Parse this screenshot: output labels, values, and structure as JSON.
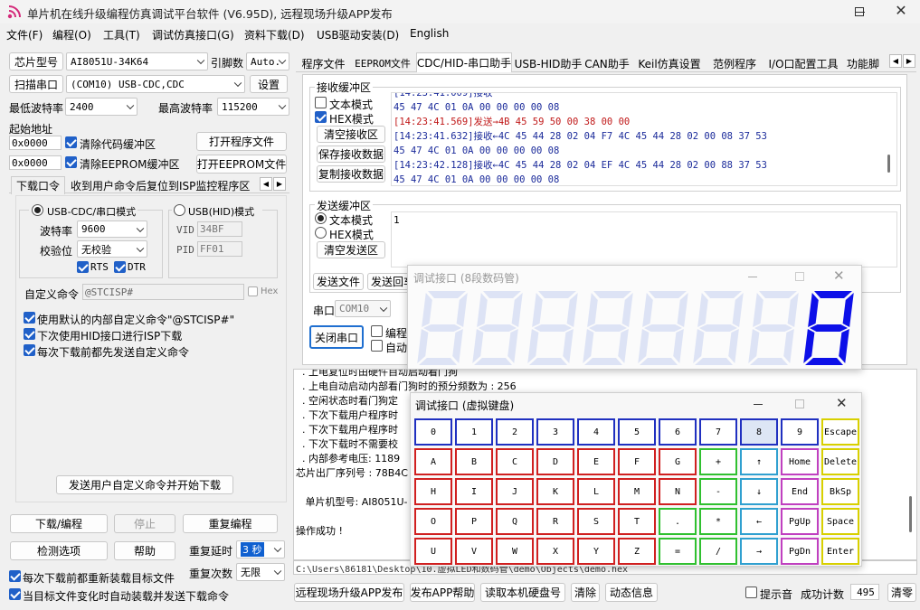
{
  "window": {
    "title": "单片机在线升级编程仿真调试平台软件 (V6.95D), 远程现场升级APP发布"
  },
  "menu": [
    "文件(F)",
    "编程(O)",
    "工具(T)",
    "调试仿真接口(G)",
    "资料下载(D)",
    "USB驱动安装(D)",
    "English"
  ],
  "left": {
    "chip_label": "芯片型号",
    "chip_value": "AI8051U-34K64",
    "pin_label": "引脚数",
    "pin_value": "Auto.",
    "scan_btn": "扫描串口",
    "port_value": "(COM10) USB-CDC,CDC",
    "settings_btn": "设置",
    "min_baud_label": "最低波特率",
    "min_baud_value": "2400",
    "max_baud_label": "最高波特率",
    "max_baud_value": "115200",
    "start_addr_label": "起始地址",
    "addr1": "0x0000",
    "clear_code": "清除代码缓冲区",
    "open_prog": "打开程序文件",
    "addr2": "0x0000",
    "clear_eeprom": "清除EEPROM缓冲区",
    "open_eeprom": "打开EEPROM文件",
    "tabs": [
      "下载口令",
      "收到用户命令后复位到ISP监控程序区"
    ],
    "mode_cdc": "USB-CDC/串口模式",
    "mode_hid": "USB(HID)模式",
    "baud_label": "波特率",
    "baud_value": "9600",
    "parity_label": "校验位",
    "parity_value": "无校验",
    "rts": "RTS",
    "dtr": "DTR",
    "vid_label": "VID",
    "vid_value": "34BF",
    "pid_label": "PID",
    "pid_value": "FF01",
    "custom_cmd_label": "自定义命令",
    "custom_cmd_value": "@STCISP#",
    "hex_label": "Hex",
    "opt1": "使用默认的内部自定义命令\"@STCISP#\"",
    "opt2": "下次使用HID接口进行ISP下载",
    "opt3": "每次下载前都先发送自定义命令",
    "send_custom_btn": "发送用户自定义命令并开始下载",
    "download_btn": "下载/编程",
    "stop_btn": "停止",
    "reprogram_btn": "重复编程",
    "check_btn": "检测选项",
    "help_btn": "帮助",
    "repeat_delay_label": "重复延时",
    "repeat_delay_value": "3 秒",
    "repeat_count_label": "重复次数",
    "repeat_count_value": "无限",
    "reload_opt": "每次下载前都重新装载目标文件",
    "auto_opt": "当目标文件变化时自动装载并发送下载命令"
  },
  "right": {
    "tabs": [
      "程序文件",
      "EEPROM文件",
      "CDC/HID-串口助手",
      "USB-HID助手",
      "CAN助手",
      "Keil仿真设置",
      "范例程序",
      "I/O口配置工具",
      "功能脚"
    ],
    "recv_title": "接收缓冲区",
    "text_mode": "文本模式",
    "hex_mode": "HEX模式",
    "clear_recv": "清空接收区",
    "save_recv": "保存接收数据",
    "copy_recv": "复制接收数据",
    "recv_lines": [
      {
        "text": "45 47 4C 01 0A 00 00 00 00 08",
        "color": "#1a2a9a"
      },
      {
        "text": "[14:23:41.569]发送→4B 45 59 50 00 38 00 00",
        "color": "#c01818"
      },
      {
        "text": "[14:23:41.632]接收←4C 45 44 28 02 04 F7 4C 45 44 28 02 00 08 37 53",
        "color": "#1a2a9a"
      },
      {
        "text": "45 47 4C 01 0A 00 00 00 00 08",
        "color": "#1a2a9a"
      },
      {
        "text": "[14:23:42.128]接收←4C 45 44 28 02 04 EF 4C 45 44 28 02 00 88 37 53",
        "color": "#1a2a9a"
      },
      {
        "text": "45 47 4C 01 0A 00 00 00 00 08",
        "color": "#1a2a9a"
      }
    ],
    "send_title": "发送缓冲区",
    "send_text_mode": "文本模式",
    "send_hex_mode": "HEX模式",
    "clear_send": "清空发送区",
    "send_value": "1",
    "send_file": "发送文件",
    "send_back": "发送回车",
    "port_label": "串口",
    "port_value": "COM10",
    "close_port": "关闭串口",
    "prog_opt": "编程完",
    "auto_opt": "自动"
  },
  "log": {
    "lines": [
      "  . 上电复位时由硬件自动启动看门狗",
      "  . 上电自动启动内部看门狗时的预分频数为 : 256",
      "  . 空闲状态时看门狗定",
      "  . 下次下载用户程序时",
      "  . 下次下载用户程序时",
      "  . 下次下载时不需要校",
      "  . 内部参考电压: 1189",
      "芯片出厂序列号 : 78B4C",
      "",
      "   单片机型号: AI8051U-",
      "",
      "操作成功 !"
    ],
    "path": "C:\\Users\\86181\\Desktop\\10.虚拟LED和数码管\\demo\\Objects\\demo.hex"
  },
  "status": {
    "remote_btn": "远程现场升级APP发布",
    "publish_help": "发布APP帮助",
    "read_disk": "读取本机硬盘号",
    "clear": "清除",
    "animation": "动态信息",
    "sound": "提示音",
    "success_label": "成功计数",
    "success_value": "495",
    "clear2": "清零"
  },
  "seg_win": {
    "title": "调试接口 (8段数码管)",
    "digits": [
      null,
      null,
      null,
      null,
      null,
      null,
      null,
      "8"
    ]
  },
  "kb_win": {
    "title": "调试接口 (虚拟键盘)",
    "rows": [
      [
        "0",
        "1",
        "2",
        "3",
        "4",
        "5",
        "6",
        "7",
        "8",
        "9",
        "Escape"
      ],
      [
        "A",
        "B",
        "C",
        "D",
        "E",
        "F",
        "G",
        "+",
        "↑",
        "Home",
        "Delete"
      ],
      [
        "H",
        "I",
        "J",
        "K",
        "L",
        "M",
        "N",
        "-",
        "↓",
        "End",
        "BkSp"
      ],
      [
        "O",
        "P",
        "Q",
        "R",
        "S",
        "T",
        ".",
        "*",
        "←",
        "PgUp",
        "Space"
      ],
      [
        "U",
        "V",
        "W",
        "X",
        "Y",
        "Z",
        "=",
        "/",
        "→",
        "PgDn",
        "Enter"
      ]
    ]
  }
}
